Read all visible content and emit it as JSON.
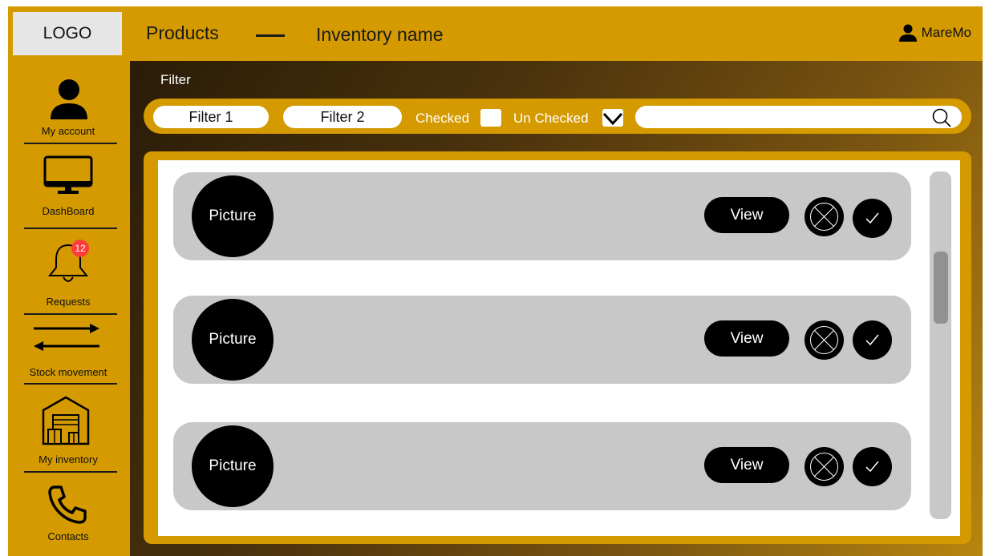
{
  "colors": {
    "accent": "#d49a00",
    "dark": "#000000",
    "row": "#c8c8c8",
    "badge": "#ff3b3b"
  },
  "logo": "LOGO",
  "header": {
    "products": "Products",
    "inventory": "Inventory name",
    "user": "MareMo",
    "user_icon": "user-icon"
  },
  "sidebar": {
    "items": [
      {
        "label": "My account",
        "icon": "user-icon"
      },
      {
        "label": "DashBoard",
        "icon": "monitor-icon"
      },
      {
        "label": "Requests",
        "icon": "bell-icon",
        "badge": "12"
      },
      {
        "label": "Stock movement",
        "icon": "arrows-icon"
      },
      {
        "label": "My inventory",
        "icon": "warehouse-icon"
      },
      {
        "label": "Contacts",
        "icon": "phone-icon"
      }
    ]
  },
  "filter": {
    "title": "Filter",
    "filter1": "Filter 1",
    "filter2": "Filter 2",
    "checked_label": "Checked",
    "unchecked_label": "Un Checked",
    "search_placeholder": ""
  },
  "rows": [
    {
      "picture": "Picture",
      "view": "View"
    },
    {
      "picture": "Picture",
      "view": "View"
    },
    {
      "picture": "Picture",
      "view": "View"
    }
  ]
}
